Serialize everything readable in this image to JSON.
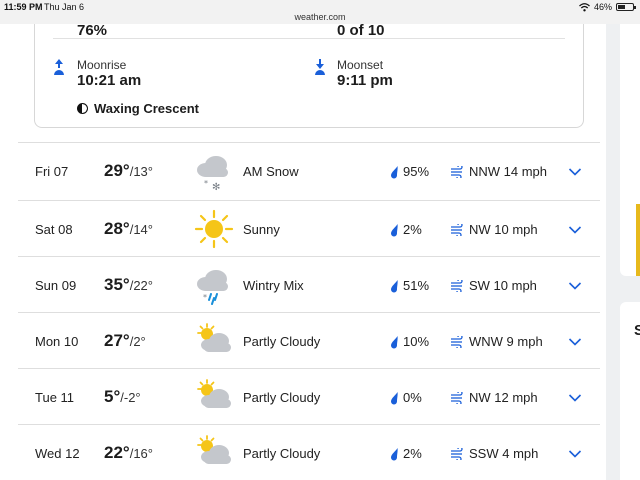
{
  "status_bar": {
    "time": "11:59 PM",
    "date": "Thu Jan 6",
    "url": "weather.com",
    "battery": "46%"
  },
  "moon": {
    "top_left_value": "76%",
    "top_right_value": "0 of 10",
    "moonrise_label": "Moonrise",
    "moonrise_time": "10:21 am",
    "moonset_label": "Moonset",
    "moonset_time": "9:11 pm",
    "phase": "Waxing Crescent"
  },
  "forecast": [
    {
      "day": "Fri 07",
      "hi": "29°",
      "lo": "/13°",
      "icon": "snow-cloud-icon",
      "condition": "AM Snow",
      "precip": "95%",
      "wind": "NNW 14 mph"
    },
    {
      "day": "Sat 08",
      "hi": "28°",
      "lo": "/14°",
      "icon": "sun-icon",
      "condition": "Sunny",
      "precip": "2%",
      "wind": "NW 10 mph"
    },
    {
      "day": "Sun 09",
      "hi": "35°",
      "lo": "/22°",
      "icon": "wintry-mix-icon",
      "condition": "Wintry Mix",
      "precip": "51%",
      "wind": "SW 10 mph"
    },
    {
      "day": "Mon 10",
      "hi": "27°",
      "lo": "/2°",
      "icon": "partly-cloudy-icon",
      "condition": "Partly Cloudy",
      "precip": "10%",
      "wind": "WNW 9 mph"
    },
    {
      "day": "Tue 11",
      "hi": "5°",
      "lo": "/-2°",
      "icon": "partly-cloudy-icon",
      "condition": "Partly Cloudy",
      "precip": "0%",
      "wind": "NW 12 mph"
    },
    {
      "day": "Wed 12",
      "hi": "22°",
      "lo": "/16°",
      "icon": "partly-cloudy-icon",
      "condition": "Partly Cloudy",
      "precip": "2%",
      "wind": "SSW 4 mph"
    }
  ],
  "right_panel_letter": "S",
  "colors": {
    "accent_blue": "#1a5fd9",
    "cloud_gray": "#bfc3c8",
    "sun_yellow": "#f5c518",
    "divider": "#dedede"
  }
}
